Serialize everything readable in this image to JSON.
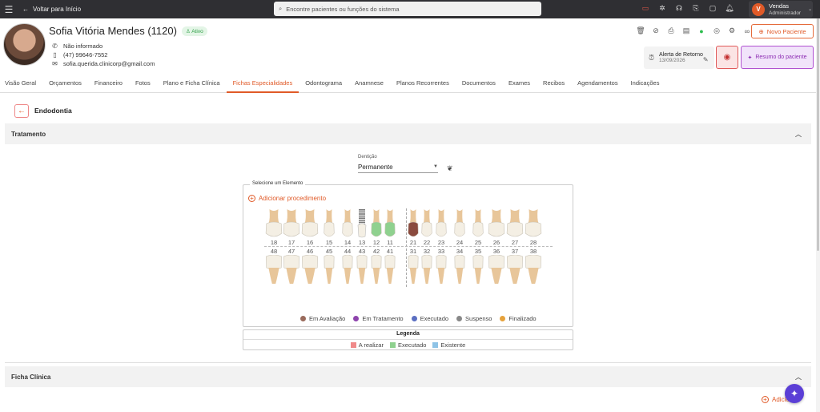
{
  "topbar": {
    "menu_icon": "hamburger-icon",
    "back_label": "Voltar para Início",
    "search_placeholder": "Encontre pacientes ou funções do sistema",
    "user_initial": "V",
    "user_name": "Vendas",
    "user_role": "Administrador"
  },
  "patient": {
    "name": "Sofia Vitória Mendes (1120)",
    "status": "Ativo",
    "phone_label": "Não informado",
    "mobile": "(47) 99646-7552",
    "email": "sofia.querida.clinicorp@gmail.com"
  },
  "header_actions": {
    "new_patient": "Novo Paciente",
    "alert_title": "Alerta de Retorno",
    "alert_date": "13/09/2026",
    "summary": "Resumo do paciente"
  },
  "tabs": [
    {
      "label": "Visão Geral"
    },
    {
      "label": "Orçamentos"
    },
    {
      "label": "Financeiro"
    },
    {
      "label": "Fotos"
    },
    {
      "label": "Plano e Ficha Clínica"
    },
    {
      "label": "Fichas Especialidades",
      "active": true
    },
    {
      "label": "Odontograma"
    },
    {
      "label": "Anamnese"
    },
    {
      "label": "Planos Recorrentes"
    },
    {
      "label": "Documentos"
    },
    {
      "label": "Exames"
    },
    {
      "label": "Recibos"
    },
    {
      "label": "Agendamentos"
    },
    {
      "label": "Indicações"
    }
  ],
  "section": {
    "title": "Endodontia",
    "panel1": "Tratamento",
    "panel2": "Ficha Clínica"
  },
  "dentition": {
    "label": "Dentição",
    "value": "Permanente"
  },
  "odontogram": {
    "title": "Selecione um Elemento",
    "add_label": "Adicionar procedimento",
    "upper_teeth": [
      "18",
      "17",
      "16",
      "15",
      "14",
      "13",
      "12",
      "11",
      "21",
      "22",
      "23",
      "24",
      "25",
      "26",
      "27",
      "28"
    ],
    "lower_teeth": [
      "48",
      "47",
      "46",
      "45",
      "44",
      "43",
      "42",
      "41",
      "31",
      "32",
      "33",
      "34",
      "35",
      "36",
      "37",
      "38"
    ],
    "upper_fills": {
      "13": "implant",
      "12": "#8fd18f",
      "11": "#8fd18f",
      "21": "#8a4a3e"
    }
  },
  "status_legend": [
    {
      "label": "Em Avaliação",
      "color": "#9a6b5c"
    },
    {
      "label": "Em Tratamento",
      "color": "#8e44ad"
    },
    {
      "label": "Executado",
      "color": "#5b6fc2"
    },
    {
      "label": "Suspenso",
      "color": "#888888"
    },
    {
      "label": "Finalizado",
      "color": "#e6a23c"
    }
  ],
  "legenda": {
    "title": "Legenda",
    "items": [
      {
        "label": "A realizar",
        "color": "#f08a8a"
      },
      {
        "label": "Executado",
        "color": "#8fd18f"
      },
      {
        "label": "Existente",
        "color": "#8ec3e6"
      }
    ]
  },
  "bottom": {
    "add_label": "Adicio"
  }
}
